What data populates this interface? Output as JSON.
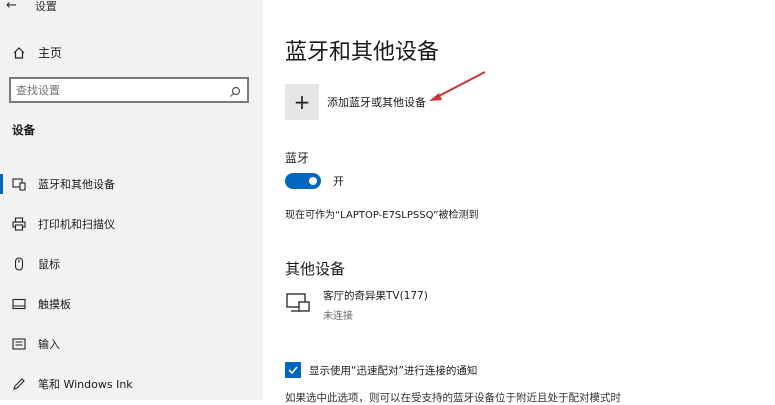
{
  "window": {
    "back_glyph": "←",
    "title": "设置"
  },
  "sidebar": {
    "home_label": "主页",
    "search": {
      "placeholder": "查找设置"
    },
    "section_title": "设备",
    "items": [
      {
        "label": "蓝牙和其他设备",
        "icon": "bluetooth-devices-icon",
        "active": true
      },
      {
        "label": "打印机和扫描仪",
        "icon": "printer-icon"
      },
      {
        "label": "鼠标",
        "icon": "mouse-icon"
      },
      {
        "label": "触摸板",
        "icon": "touchpad-icon"
      },
      {
        "label": "输入",
        "icon": "keyboard-icon"
      },
      {
        "label": "笔和 Windows Ink",
        "icon": "pen-icon"
      }
    ]
  },
  "main": {
    "title": "蓝牙和其他设备",
    "add_device": {
      "glyph": "+",
      "label": "添加蓝牙或其他设备"
    },
    "bluetooth": {
      "title": "蓝牙",
      "toggle_state": "开",
      "on": true
    },
    "discoverable_text": "现在可作为“LAPTOP-E7SLPSSQ”被检测到",
    "other_devices": {
      "title": "其他设备",
      "devices": [
        {
          "name": "客厅的奇异果TV(177)",
          "status": "未连接",
          "icon": "display-device-icon"
        }
      ]
    },
    "swift_pair": {
      "checked": true,
      "label": "显示使用“迅速配对”进行连接的通知"
    },
    "cut_text": "如果选中此选项，则可以在受支持的蓝牙设备位于附近且处于配对模式时"
  },
  "colors": {
    "accent": "#0067c0",
    "sidebar_bg": "#f2f2f2",
    "arrow": "#d03030"
  }
}
